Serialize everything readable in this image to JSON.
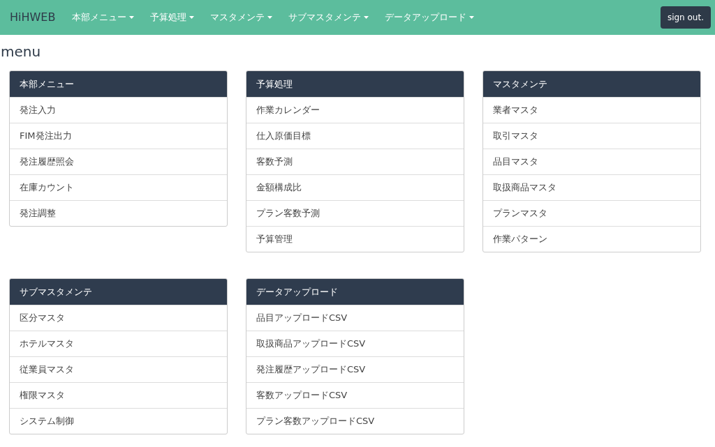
{
  "navbar": {
    "brand": "HiHWEB",
    "items": [
      {
        "label": "本部メニュー",
        "caret": true
      },
      {
        "label": "予算処理",
        "caret": true
      },
      {
        "label": "マスタメンテ",
        "caret": true
      },
      {
        "label": "サブマスタメンテ",
        "caret": true
      },
      {
        "label": "データアップロード",
        "caret": true
      }
    ],
    "sign_out": "sign out."
  },
  "heading": "menu",
  "panels": [
    {
      "title": "本部メニュー",
      "items": [
        "発注入力",
        "FIM発注出力",
        "発注履歴照会",
        "在庫カウント",
        "発注調整"
      ]
    },
    {
      "title": "予算処理",
      "items": [
        "作業カレンダー",
        "仕入原価目標",
        "客数予測",
        "金額構成比",
        "プラン客数予測",
        "予算管理"
      ]
    },
    {
      "title": "マスタメンテ",
      "items": [
        "業者マスタ",
        "取引マスタ",
        "品目マスタ",
        "取扱商品マスタ",
        "プランマスタ",
        "作業パターン"
      ]
    },
    {
      "title": "サブマスタメンテ",
      "items": [
        "区分マスタ",
        "ホテルマスタ",
        "従業員マスタ",
        "権限マスタ",
        "システム制御"
      ]
    },
    {
      "title": "データアップロード",
      "items": [
        "品目アップロードCSV",
        "取扱商品アップロードCSV",
        "発注履歴アップロードCSV",
        "客数アップロードCSV",
        "プラン客数アップロードCSV"
      ]
    }
  ]
}
